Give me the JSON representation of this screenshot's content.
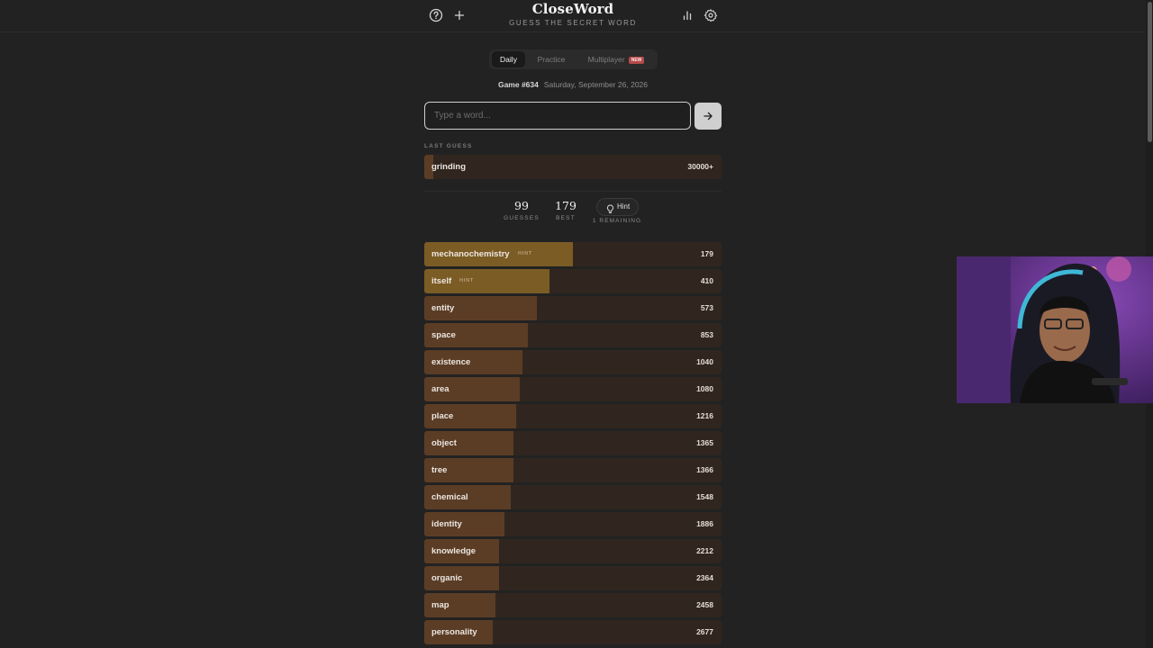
{
  "header": {
    "title": "CloseWord",
    "subtitle": "GUESS THE SECRET WORD"
  },
  "icons": {
    "help": "help-circle-icon",
    "new_game": "plus-icon",
    "stats": "bar-chart-icon",
    "settings": "gear-icon",
    "submit": "arrow-right-icon",
    "hint": "lightbulb-icon"
  },
  "tabs": [
    {
      "label": "Daily",
      "active": true
    },
    {
      "label": "Practice",
      "active": false
    },
    {
      "label": "Multiplayer",
      "active": false,
      "badge": "NEW"
    }
  ],
  "game": {
    "number": "Game #634",
    "date": "Saturday, September 26, 2026"
  },
  "input": {
    "placeholder": "Type a word...",
    "value": ""
  },
  "last_guess": {
    "label": "LAST GUESS",
    "word": "grinding",
    "rank": "30000+",
    "closeness": 0.03
  },
  "stats": {
    "guesses_value": "99",
    "guesses_label": "GUESSES",
    "best_value": "179",
    "best_label": "BEST",
    "hint_label": "Hint",
    "hint_remaining": "1 REMAINING"
  },
  "guesses": [
    {
      "word": "mechanochemistry",
      "hint": true,
      "tag": "HINT",
      "rank": "179",
      "closeness": 0.5
    },
    {
      "word": "itself",
      "hint": true,
      "tag": "HINT",
      "rank": "410",
      "closeness": 0.42
    },
    {
      "word": "entity",
      "hint": false,
      "rank": "573",
      "closeness": 0.38
    },
    {
      "word": "space",
      "hint": false,
      "rank": "853",
      "closeness": 0.35
    },
    {
      "word": "existence",
      "hint": false,
      "rank": "1040",
      "closeness": 0.33
    },
    {
      "word": "area",
      "hint": false,
      "rank": "1080",
      "closeness": 0.32
    },
    {
      "word": "place",
      "hint": false,
      "rank": "1216",
      "closeness": 0.31
    },
    {
      "word": "object",
      "hint": false,
      "rank": "1365",
      "closeness": 0.3
    },
    {
      "word": "tree",
      "hint": false,
      "rank": "1366",
      "closeness": 0.3
    },
    {
      "word": "chemical",
      "hint": false,
      "rank": "1548",
      "closeness": 0.29
    },
    {
      "word": "identity",
      "hint": false,
      "rank": "1886",
      "closeness": 0.27
    },
    {
      "word": "knowledge",
      "hint": false,
      "rank": "2212",
      "closeness": 0.25
    },
    {
      "word": "organic",
      "hint": false,
      "rank": "2364",
      "closeness": 0.25
    },
    {
      "word": "map",
      "hint": false,
      "rank": "2458",
      "closeness": 0.24
    },
    {
      "word": "personality",
      "hint": false,
      "rank": "2677",
      "closeness": 0.23
    }
  ],
  "colors": {
    "background": "#222222",
    "bar_track": "#30261f",
    "bar_fill": "#5b3d26",
    "bar_fill_hint": "#7b5c25"
  }
}
